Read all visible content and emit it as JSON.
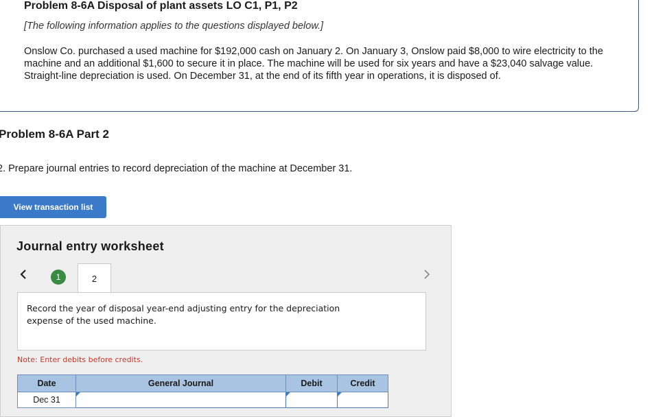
{
  "problem": {
    "title": "Problem 8-6A Disposal of plant assets LO C1, P1, P2",
    "subtitle": "[The following information applies to the questions displayed below.]",
    "body": "Onslow Co. purchased a used machine for $192,000 cash on January 2. On January 3, Onslow paid $8,000 to wire electricity to the machine and an additional $1,600 to secure it in place. The machine will be used for six years and have a $23,040 salvage value. Straight-line depreciation is used. On December 31, at the end of its fifth year in operations, it is disposed of."
  },
  "part": {
    "title": "Problem 8-6A Part 2",
    "instruction": "2. Prepare journal entries to record depreciation of the machine at December 31."
  },
  "buttons": {
    "view_transactions": "View transaction list"
  },
  "worksheet": {
    "title": "Journal entry worksheet",
    "steps": [
      "1",
      "2"
    ],
    "current_step": "2",
    "record_text": "Record the year of disposal year-end adjusting entry for the depreciation expense of the used machine.",
    "note": "Note: Enter debits before credits.",
    "table": {
      "headers": [
        "Date",
        "General Journal",
        "Debit",
        "Credit"
      ],
      "rows": [
        {
          "date": "Dec 31",
          "account": "",
          "debit": "",
          "credit": ""
        }
      ]
    }
  },
  "colors": {
    "button_blue": "#3b7ac9",
    "step_done_green": "#3a8a44",
    "header_blue": "#a9c4e3",
    "note_red": "#c0392b"
  },
  "icons": [
    "chevron-left-icon",
    "chevron-right-icon"
  ]
}
